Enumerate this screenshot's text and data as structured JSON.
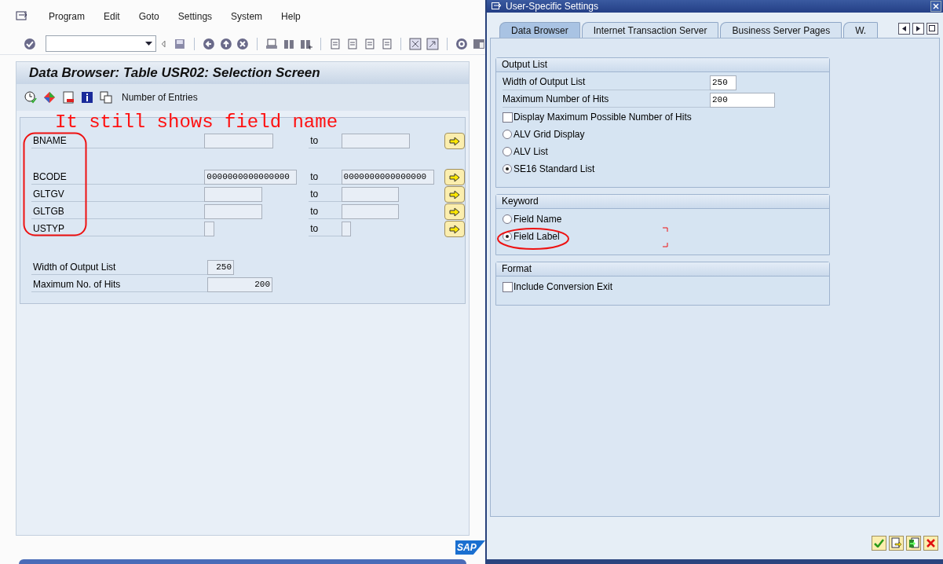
{
  "main_window": {
    "menu": [
      {
        "label": "Program"
      },
      {
        "label": "Edit"
      },
      {
        "label": "Goto"
      },
      {
        "label": "Settings"
      },
      {
        "label": "System"
      },
      {
        "label": "Help"
      }
    ],
    "screen_title": "Data Browser: Table USR02: Selection Screen",
    "app_toolbar": {
      "entries_button": "Number of Entries"
    },
    "annotation": "It still shows field name",
    "selection_rows": [
      {
        "field": "BNAME",
        "low": "",
        "to": "to",
        "high": ""
      },
      {
        "field": "BCODE",
        "low": "0000000000000000",
        "to": "to",
        "high": "0000000000000000"
      },
      {
        "field": "GLTGV",
        "low": "",
        "to": "to",
        "high": ""
      },
      {
        "field": "GLTGB",
        "low": "",
        "to": "to",
        "high": ""
      },
      {
        "field": "USTYP",
        "low": "",
        "to": "to",
        "high": ""
      }
    ],
    "options": [
      {
        "label": "Width of Output List",
        "value": "250"
      },
      {
        "label": "Maximum No. of Hits",
        "value": "200"
      }
    ],
    "logo": "SAP"
  },
  "dialog": {
    "title": "User-Specific Settings",
    "tabs": [
      {
        "label": "Data Browser",
        "selected": true
      },
      {
        "label": "Internet Transaction Server",
        "selected": false
      },
      {
        "label": "Business Server Pages",
        "selected": false
      },
      {
        "label": "W.",
        "selected": false
      }
    ],
    "groups": [
      {
        "title": "Output List",
        "items": [
          {
            "kind": "field",
            "label": "Width of Output List",
            "value": "250"
          },
          {
            "kind": "field",
            "label": "Maximum Number of Hits",
            "value": "200"
          },
          {
            "kind": "checkbox",
            "label": "Display Maximum Possible Number of Hits",
            "checked": false
          },
          {
            "kind": "radio",
            "label": "ALV Grid Display",
            "selected": false
          },
          {
            "kind": "radio",
            "label": "ALV List",
            "selected": false
          },
          {
            "kind": "radio",
            "label": "SE16 Standard List",
            "selected": true
          }
        ]
      },
      {
        "title": "Keyword",
        "items": [
          {
            "kind": "radio",
            "label": "Field Name",
            "selected": false
          },
          {
            "kind": "radio",
            "label": "Field Label",
            "selected": true
          }
        ]
      },
      {
        "title": "Format",
        "items": [
          {
            "kind": "checkbox",
            "label": "Include Conversion Exit",
            "checked": false
          }
        ]
      }
    ]
  }
}
